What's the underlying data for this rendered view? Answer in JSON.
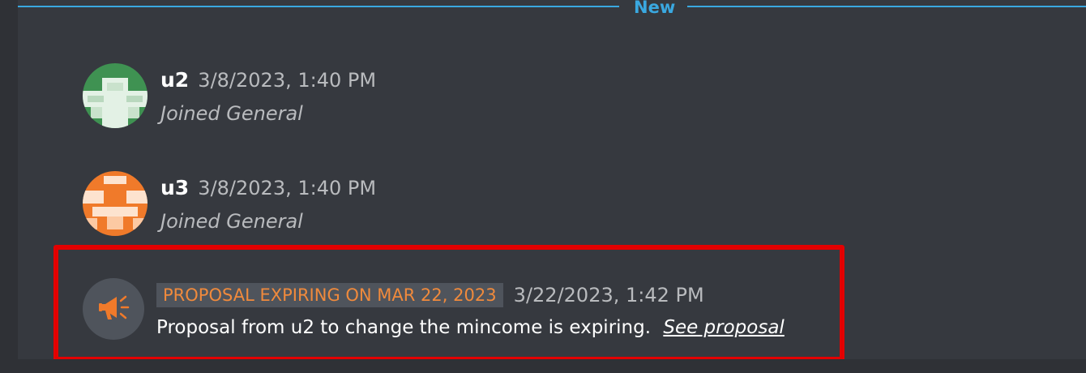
{
  "divider": {
    "label": "New"
  },
  "messages": [
    {
      "username": "u2",
      "timestamp": "3/8/2023, 1:40 PM",
      "text": "Joined General"
    },
    {
      "username": "u3",
      "timestamp": "3/8/2023, 1:40 PM",
      "text": "Joined General"
    }
  ],
  "system_message": {
    "badge": "PROPOSAL EXPIRING ON MAR 22, 2023",
    "timestamp": "3/22/2023, 1:42 PM",
    "text": "Proposal from u2 to change the mincome is expiring.",
    "link_label": "See proposal",
    "icon": "megaphone-icon"
  },
  "colors": {
    "background": "#36393f",
    "divider": "#3aa8e0",
    "badge_text": "#f08a3c",
    "highlight": "#e30000",
    "avatar_u2": "#3f9252",
    "avatar_u3": "#f07a2a"
  }
}
